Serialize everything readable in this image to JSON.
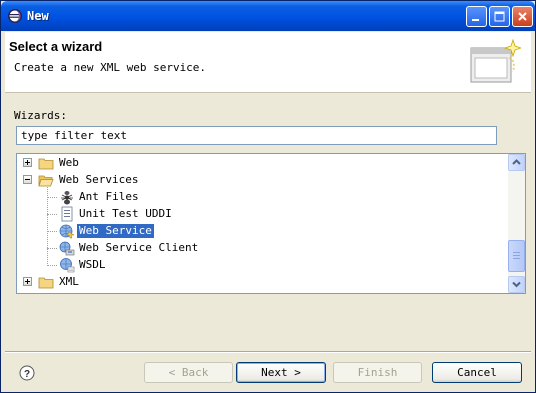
{
  "window": {
    "title": "New"
  },
  "header": {
    "title": "Select a wizard",
    "description": "Create a new XML web service."
  },
  "wizards_label": "Wizards:",
  "filter": {
    "value": "type filter text"
  },
  "tree": {
    "items": [
      {
        "label": "Web",
        "expander": "plus",
        "icon": "folder-icon"
      },
      {
        "label": "Web Services",
        "expander": "minus",
        "icon": "folder-open-icon"
      },
      {
        "label": "Ant Files",
        "icon": "ant-icon"
      },
      {
        "label": "Unit Test UDDI",
        "icon": "uddi-icon"
      },
      {
        "label": "Web Service",
        "icon": "web-service-icon",
        "selected": true
      },
      {
        "label": "Web Service Client",
        "icon": "web-service-client-icon"
      },
      {
        "label": "WSDL",
        "icon": "wsdl-icon"
      },
      {
        "label": "XML",
        "expander": "plus",
        "icon": "folder-icon"
      }
    ]
  },
  "buttons": {
    "back": "< Back",
    "next": "Next >",
    "finish": "Finish",
    "cancel": "Cancel"
  },
  "colors": {
    "selection": "#316ac5",
    "titlebar": "#0054e3"
  }
}
